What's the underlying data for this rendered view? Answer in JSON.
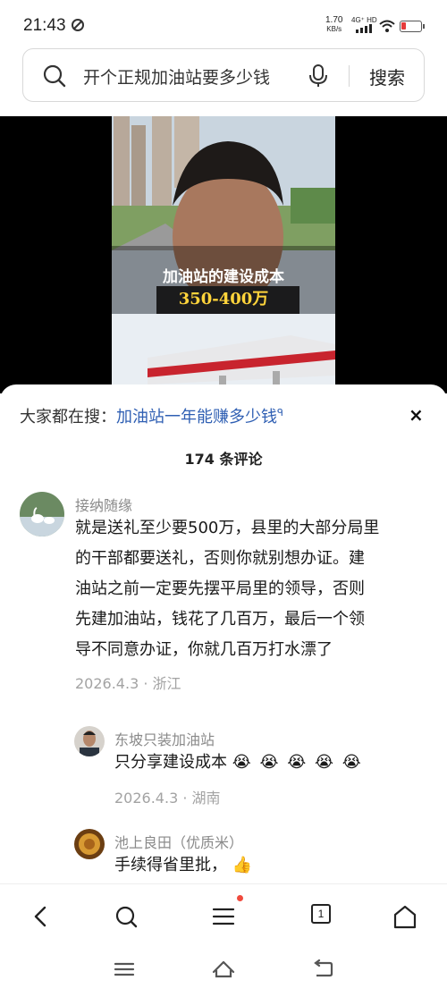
{
  "status_bar": {
    "time": "21:43",
    "speed_value": "1.70",
    "speed_unit": "KB/s",
    "network": "4G⁺ HD",
    "battery_color": "#e63b3b"
  },
  "search": {
    "query": "开个正规加油站要多少钱",
    "button_label": "搜索"
  },
  "video": {
    "caption_line1": "加油站的建设成本",
    "caption_line2": "350-400万"
  },
  "comments_panel": {
    "hot_search_prefix": "大家都在搜：",
    "hot_search_link": "加油站一年能赚多少钱",
    "hot_search_icon": "search-small-icon",
    "close_label": "×",
    "count_label": "174 条评论",
    "comments": [
      {
        "author": "接纳随缘",
        "text_lines": [
          "就是送礼至少要500万，县里的大部分局里",
          "的干部都要送礼，否则你就别想办证。建",
          "油站之前一定要先摆平局里的领导，否则",
          "先建加油站，钱花了几百万，最后一个领",
          "导不同意办证，你就几百万打水漂了"
        ],
        "meta": "2026.4.3 · 浙江"
      },
      {
        "author": "东坡只装加油站",
        "text": "只分享建设成本",
        "emojis": "😭 😭 😭 😭 😭",
        "meta": "2026.4.3 · 湖南"
      },
      {
        "author": "池上良田（优质米）",
        "text": "手续得省里批，",
        "emojis": "👍"
      }
    ]
  },
  "bottom_nav": {
    "tab_count": "1",
    "items": [
      "back-icon",
      "search-icon",
      "menu-icon",
      "tabs-icon",
      "home-icon"
    ]
  },
  "system_nav": [
    "menu-icon",
    "home-icon",
    "back-icon"
  ]
}
